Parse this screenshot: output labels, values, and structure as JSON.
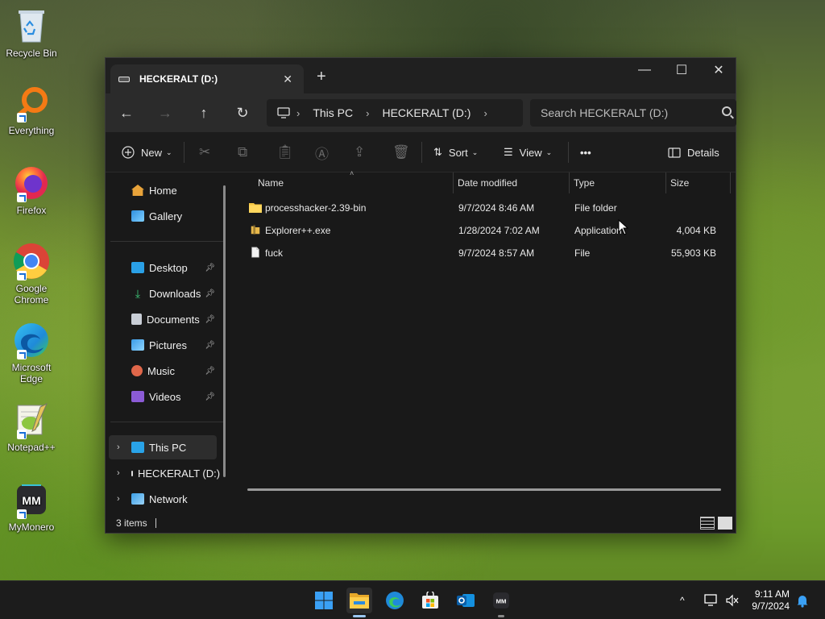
{
  "desktop": {
    "icons": [
      {
        "label": "Recycle Bin"
      },
      {
        "label": "Everything"
      },
      {
        "label": "Firefox"
      },
      {
        "label": "Google Chrome"
      },
      {
        "label": "Microsoft Edge"
      },
      {
        "label": "Notepad++"
      },
      {
        "label": "MyMonero"
      }
    ]
  },
  "window": {
    "tab_title": "HECKERALT (D:)",
    "new_tab": "+",
    "controls": {
      "minimize": "—",
      "maximize": "☐",
      "close": "✕"
    },
    "address": {
      "crumbs": [
        "This PC",
        "HECKERALT (D:)"
      ]
    },
    "search_placeholder": "Search HECKERALT (D:)",
    "toolbar": {
      "new_label": "New",
      "sort_label": "Sort",
      "view_label": "View",
      "more_label": "•••",
      "details_label": "Details"
    },
    "nav": {
      "home": "Home",
      "gallery": "Gallery",
      "desktop": "Desktop",
      "downloads": "Downloads",
      "documents": "Documents",
      "pictures": "Pictures",
      "music": "Music",
      "videos": "Videos",
      "this_pc": "This PC",
      "drive": "HECKERALT (D:)",
      "network": "Network"
    },
    "columns": {
      "name": "Name",
      "date": "Date modified",
      "type": "Type",
      "size": "Size"
    },
    "files": [
      {
        "name": "processhacker-2.39-bin",
        "date": "9/7/2024 8:46 AM",
        "type": "File folder",
        "size": "",
        "icon": "folder-icon"
      },
      {
        "name": "Explorer++.exe",
        "date": "1/28/2024 7:02 AM",
        "type": "Application",
        "size": "4,004 KB",
        "icon": "app-icon"
      },
      {
        "name": "fuck",
        "date": "9/7/2024 8:57 AM",
        "type": "File",
        "size": "55,903 KB",
        "icon": "file-icon"
      }
    ],
    "status": {
      "items": "3 items"
    }
  },
  "taskbar": {
    "clock": {
      "time": "9:11 AM",
      "date": "9/7/2024"
    },
    "tray_chevron": "^"
  }
}
